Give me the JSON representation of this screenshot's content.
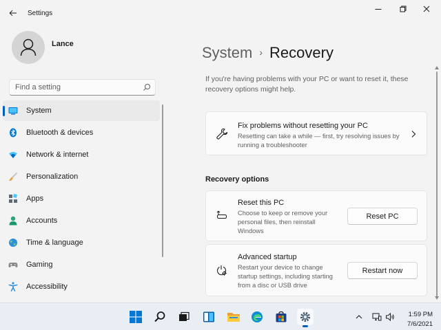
{
  "app": {
    "title": "Settings"
  },
  "user": {
    "name": "Lance"
  },
  "search": {
    "placeholder": "Find a setting"
  },
  "sidebar": {
    "items": [
      {
        "label": "System",
        "icon": "system-icon",
        "active": true
      },
      {
        "label": "Bluetooth & devices",
        "icon": "bluetooth-icon"
      },
      {
        "label": "Network & internet",
        "icon": "network-icon"
      },
      {
        "label": "Personalization",
        "icon": "brush-icon"
      },
      {
        "label": "Apps",
        "icon": "apps-icon"
      },
      {
        "label": "Accounts",
        "icon": "accounts-icon"
      },
      {
        "label": "Time & language",
        "icon": "globe-icon"
      },
      {
        "label": "Gaming",
        "icon": "gamepad-icon"
      },
      {
        "label": "Accessibility",
        "icon": "accessibility-icon"
      }
    ]
  },
  "breadcrumb": {
    "parent": "System",
    "separator": "›",
    "current": "Recovery"
  },
  "intro": "If you're having problems with your PC or want to reset it, these recovery options might help.",
  "fix_card": {
    "title": "Fix problems without resetting your PC",
    "desc": "Resetting can take a while — first, try resolving issues by running a troubleshooter"
  },
  "recovery_section": {
    "title": "Recovery options"
  },
  "reset_card": {
    "title": "Reset this PC",
    "desc": "Choose to keep or remove your personal files, then reinstall Windows",
    "button": "Reset PC"
  },
  "advanced_card": {
    "title": "Advanced startup",
    "desc": "Restart your device to change startup settings, including starting from a disc or USB drive",
    "button": "Restart now"
  },
  "taskbar": {
    "apps": [
      "start-icon",
      "search-icon",
      "task-view-icon",
      "widgets-icon",
      "file-explorer-icon",
      "edge-icon",
      "store-icon",
      "settings-icon"
    ],
    "time": "1:59 PM",
    "date": "7/6/2021"
  },
  "colors": {
    "accent": "#005fb8",
    "background": "#f3f3f3",
    "card": "#fbfbfb",
    "taskbar": "#e9eef5"
  }
}
